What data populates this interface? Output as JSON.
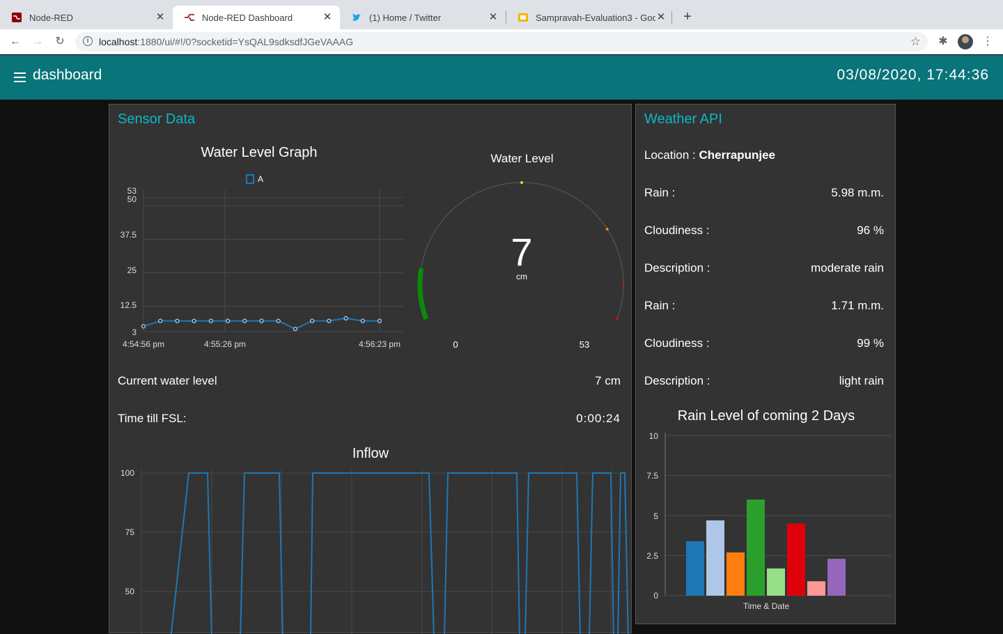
{
  "browser": {
    "tabs": [
      {
        "title": "Node-RED"
      },
      {
        "title": "Node-RED Dashboard"
      },
      {
        "title": "(1) Home / Twitter"
      },
      {
        "title": "Sampravah-Evaluation3 - Goog"
      }
    ],
    "url_host": "localhost",
    "url_rest": ":1880/ui/#!/0?socketid=YsQAL9sdksdfJGeVAAAG"
  },
  "header": {
    "title": "dashboard",
    "datetime": "03/08/2020, 17:44:36"
  },
  "sensor_group": {
    "title": "Sensor Data",
    "graph_title": "Water Level Graph",
    "legend_label": "A",
    "y_ticks": [
      "53",
      "50",
      "37.5",
      "25",
      "12.5",
      "3"
    ],
    "x_ticks": [
      "4:54:56 pm",
      "4:55:26 pm",
      "4:56:23 pm"
    ],
    "gauge_title": "Water Level",
    "gauge_value": "7",
    "gauge_units": "cm",
    "gauge_min": "0",
    "gauge_max": "53",
    "current_label": "Current water level",
    "current_value": "7 cm",
    "fsl_label": "Time till FSL:",
    "fsl_value": "0:00:24",
    "inflow_title": "Inflow",
    "inflow_y_ticks": [
      "100",
      "75",
      "50"
    ]
  },
  "weather_group": {
    "title": "Weather API",
    "location_label": "Location :",
    "location_value": "Cherrapunjee",
    "rows": [
      {
        "label": "Rain :",
        "value": "5.98 m.m."
      },
      {
        "label": "Cloudiness :",
        "value": "96 %"
      },
      {
        "label": "Description :",
        "value": "moderate rain"
      },
      {
        "label": "Rain :",
        "value": "1.71 m.m."
      },
      {
        "label": "Cloudiness :",
        "value": "99 %"
      },
      {
        "label": "Description :",
        "value": "light rain"
      }
    ],
    "chart_title": "Rain Level of coming 2 Days",
    "chart_xlabel": "Time & Date",
    "chart_y_ticks": [
      "10",
      "7.5",
      "5",
      "2.5",
      "0"
    ]
  },
  "colors": {
    "header": "#097479",
    "group_title": "#0bb8c6",
    "line": "#1f77b4"
  },
  "chart_data": [
    {
      "type": "line",
      "title": "Water Level Graph",
      "ylim": [
        3,
        53
      ],
      "series": [
        {
          "name": "A",
          "values": [
            5,
            7,
            7,
            7,
            7,
            7,
            7,
            7,
            7,
            4,
            7,
            7,
            8,
            7,
            7
          ]
        }
      ]
    },
    {
      "type": "gauge",
      "title": "Water Level",
      "value": 7,
      "min": 0,
      "max": 53,
      "units": "cm"
    },
    {
      "type": "line",
      "title": "Inflow",
      "ylim": [
        40,
        100
      ],
      "values": [
        30,
        100,
        100,
        30,
        30,
        100,
        100,
        30,
        30,
        100,
        100,
        30,
        30,
        100,
        100,
        30,
        30,
        100,
        100,
        30,
        30,
        100,
        100,
        30,
        30,
        100,
        100,
        30
      ]
    },
    {
      "type": "bar",
      "title": "Rain Level of coming 2 Days",
      "xlabel": "Time & Date",
      "ylim": [
        0,
        10
      ],
      "values": [
        3.4,
        4.7,
        2.7,
        6.0,
        1.7,
        4.5,
        0.9,
        2.3
      ],
      "colors": [
        "#1f77b4",
        "#aec7e8",
        "#ff7f0e",
        "#2ca02c",
        "#98df8a",
        "#e0000a",
        "#ff9896",
        "#9467bd"
      ]
    }
  ]
}
